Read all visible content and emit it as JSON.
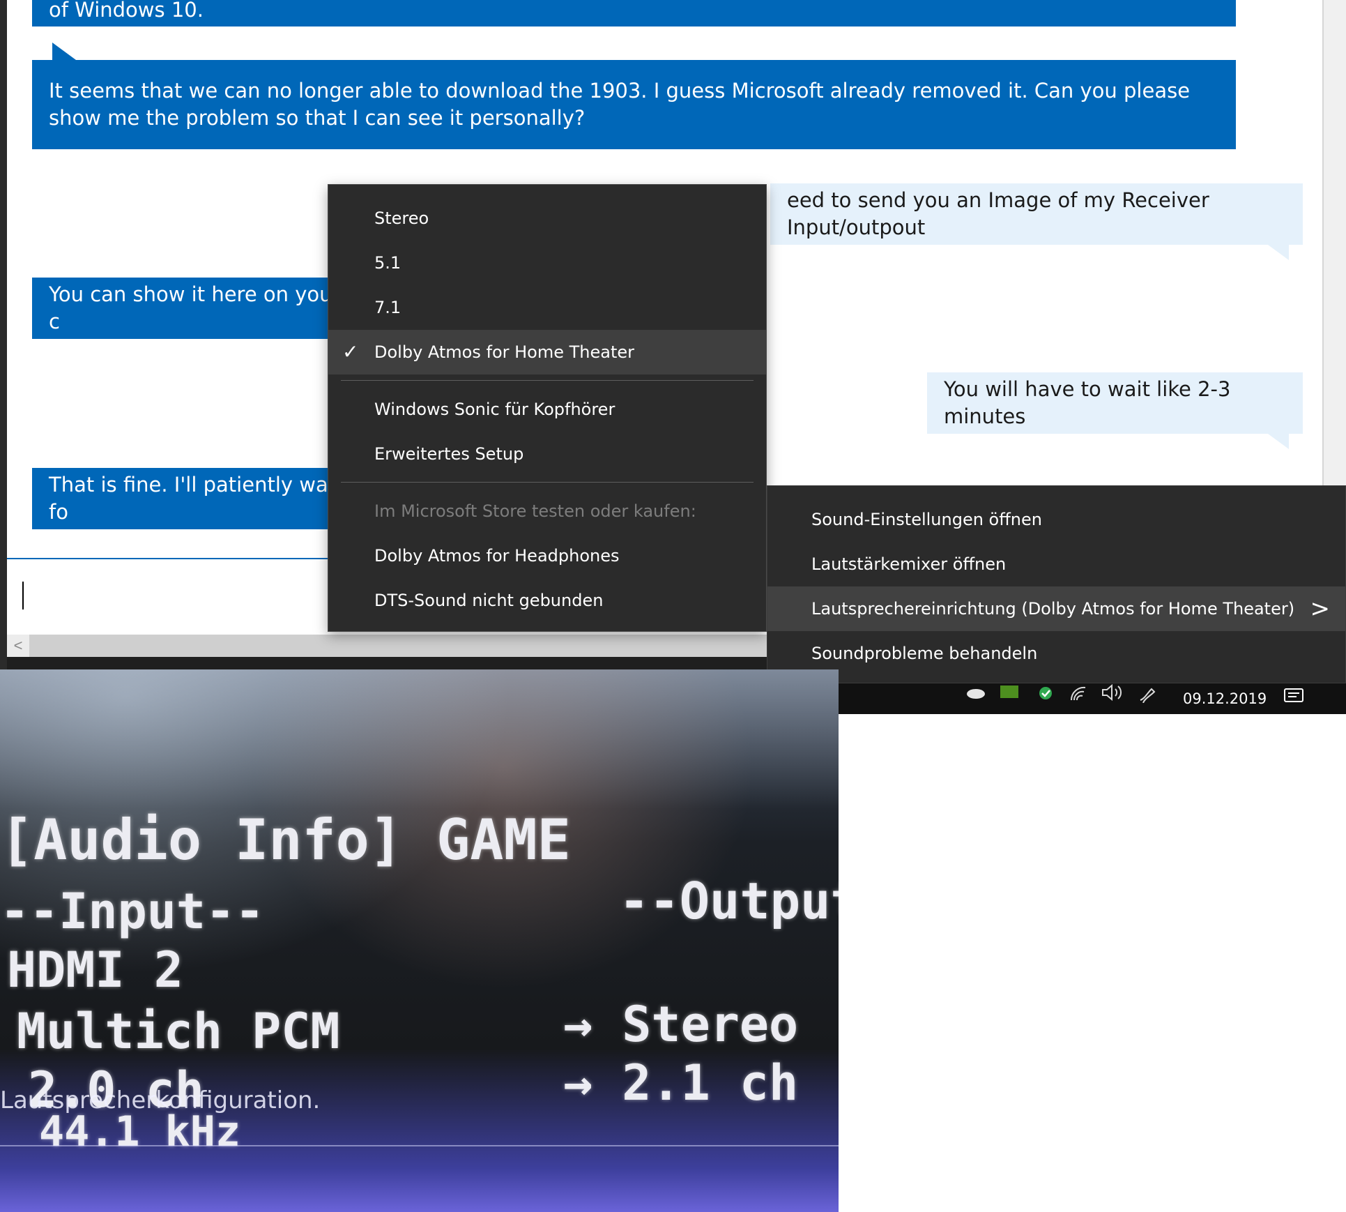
{
  "chat": {
    "messages": [
      {
        "from": "agent",
        "text": "of Windows 10."
      },
      {
        "from": "agent",
        "text": "It seems that we can no longer able to download the 1903. I guess Microsoft already removed it. Can you please show me the problem so that I can see it personally?"
      },
      {
        "from": "user",
        "text": "eed to send you an Image of my Receiver Input/outpout"
      },
      {
        "from": "agent",
        "text": "You can show it here on your c"
      },
      {
        "from": "user",
        "text": "You will have to wait like 2-3 minutes"
      },
      {
        "from": "agent",
        "text": "That is fine. I'll patiently wait fo"
      }
    ],
    "input_value": "",
    "scroll_left_glyph": "<"
  },
  "speaker_menu": {
    "items": [
      {
        "label": "Stereo",
        "checked": false
      },
      {
        "label": "5.1",
        "checked": false
      },
      {
        "label": "7.1",
        "checked": false
      },
      {
        "label": "Dolby Atmos for Home Theater",
        "checked": true
      },
      {
        "label": "Windows Sonic für Kopfhörer",
        "checked": false
      },
      {
        "label": "Erweitertes Setup",
        "checked": false
      }
    ],
    "store_header": "Im Microsoft Store testen oder kaufen:",
    "store_items": [
      {
        "label": "Dolby Atmos for Headphones"
      },
      {
        "label": "DTS-Sound nicht gebunden"
      }
    ],
    "check_glyph": "✓"
  },
  "sound_menu": {
    "items": [
      {
        "label": "Sound-Einstellungen öffnen"
      },
      {
        "label": "Lautstärkemixer öffnen"
      },
      {
        "label": "Lautsprechereinrichtung (Dolby Atmos for Home Theater)",
        "has_submenu": true
      },
      {
        "label": "Soundprobleme behandeln"
      }
    ],
    "chevron_glyph": ">"
  },
  "taskbar": {
    "date": "09.12.2019",
    "icons": [
      "onedrive-icon",
      "nvidia-icon",
      "defender-icon",
      "wifi-icon",
      "volume-icon",
      "pen-icon",
      "action-center-icon"
    ]
  },
  "receiver": {
    "header": "[Audio Info] GAME",
    "input_label": "--Input--",
    "output_label": "--Output-",
    "source": "HDMI 2",
    "input_format": "Multich PCM",
    "output_format": "→ Stereo",
    "input_channels": "2.0 ch",
    "output_channels": "→ 2.1 ch",
    "sample_rate": "44.1 kHz",
    "overlay_caption": "Lautsprecherkonfiguration."
  },
  "colors": {
    "agent_bubble": "#0067b8",
    "user_bubble": "#e5f1fb",
    "menu_bg": "#2b2b2b",
    "menu_highlight": "#3f3f3f"
  }
}
